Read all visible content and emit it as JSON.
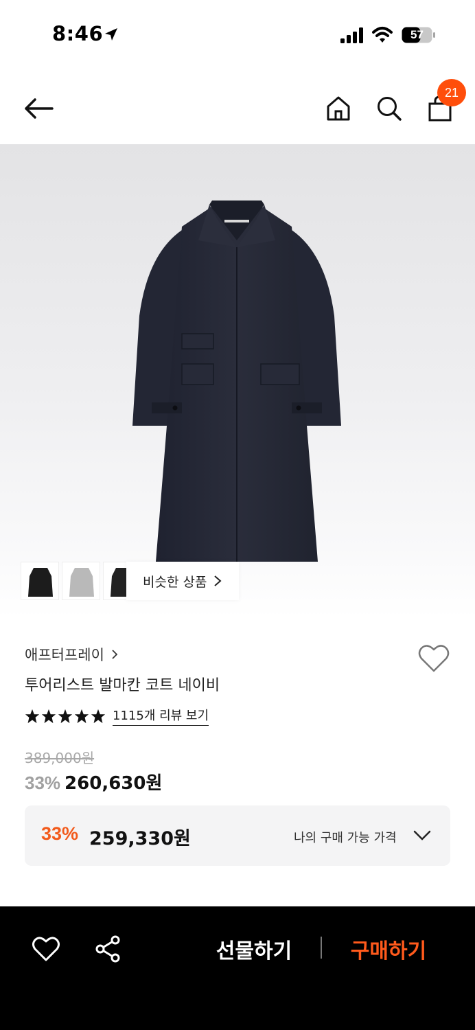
{
  "status_bar": {
    "time": "8:46",
    "battery": "57",
    "icons": [
      "location-arrow-icon",
      "signal-icon",
      "wifi-icon",
      "battery-icon"
    ]
  },
  "header": {
    "icons": [
      "back-arrow-icon",
      "home-icon",
      "search-icon",
      "shopping-bag-icon"
    ],
    "cart_count": "21",
    "badge_color": "#ff4e0b"
  },
  "gallery": {
    "image": "navy-coat-icon",
    "thumbnails": [
      "black-coat",
      "grey-coat",
      "black-coat"
    ],
    "similar_label": "비슷한 상품"
  },
  "product": {
    "brand": "애프터프레이",
    "name": "투어리스트 발마칸 코트 네이비",
    "rating_stars": 5,
    "review_link": "1115개 리뷰 보기",
    "original_price": "389,000원",
    "discount_pct": "33%",
    "sale_price": "260,630원"
  },
  "my_price": {
    "discount_pct": "33%",
    "price": "259,330원",
    "label": "나의 구매 가능 가격",
    "accent": "#f25a1b"
  },
  "bottom_bar": {
    "gift_label": "선물하기",
    "buy_label": "구매하기",
    "buy_color": "#ff5a1c",
    "icons": [
      "heart-icon",
      "share-icon"
    ]
  }
}
